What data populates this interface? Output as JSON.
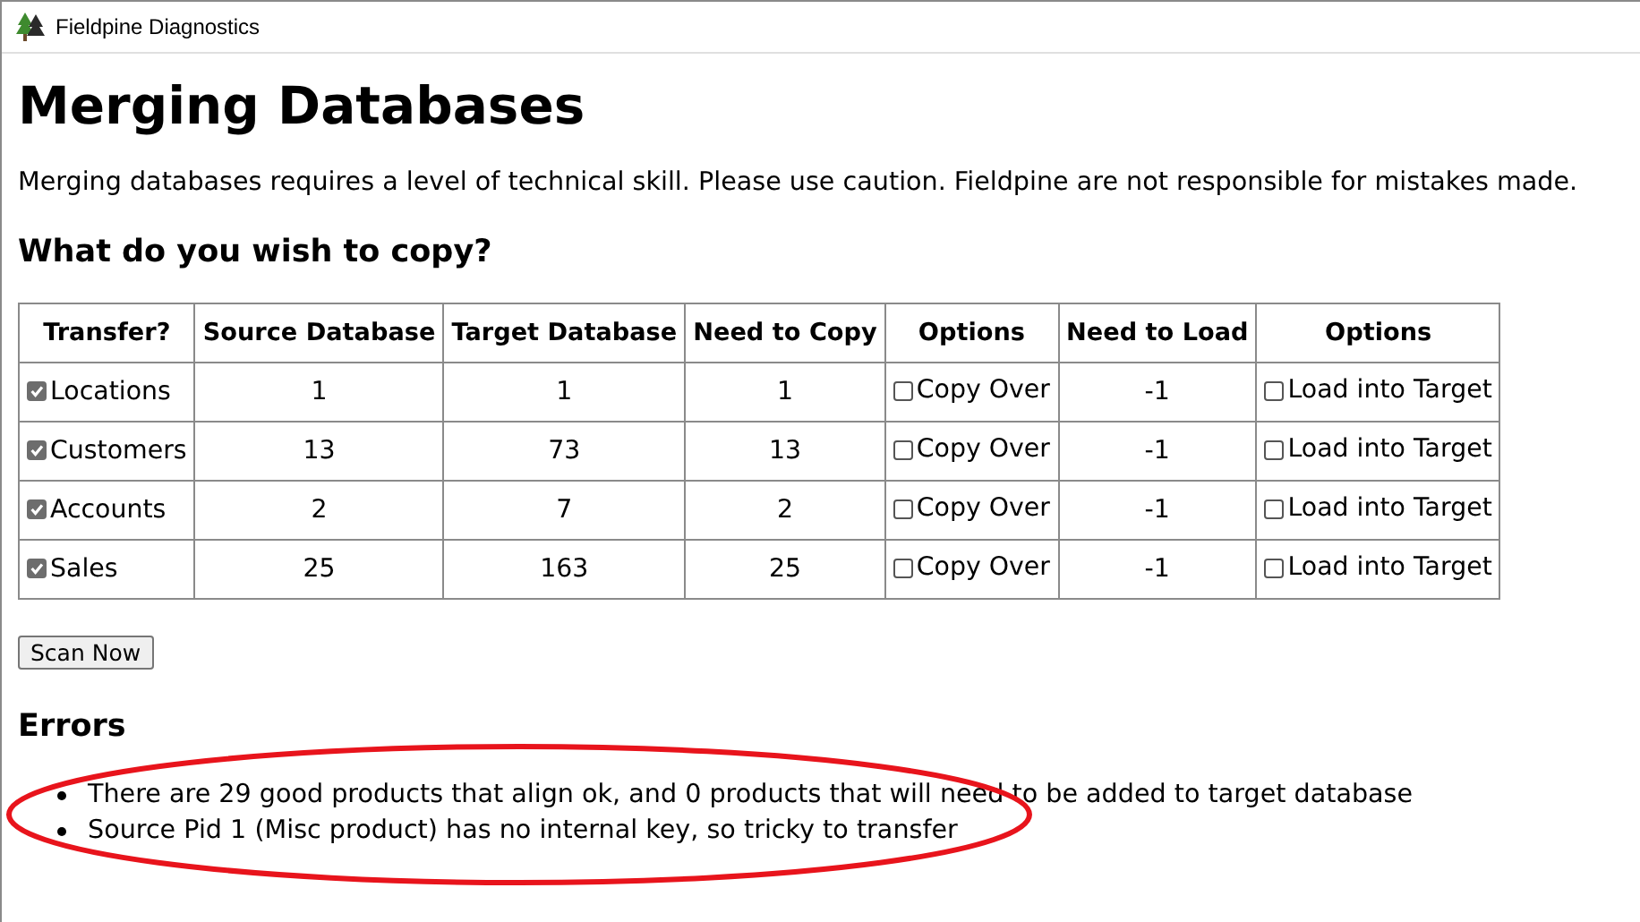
{
  "window": {
    "title": "Fieldpine Diagnostics"
  },
  "heading": "Merging Databases",
  "warning": "Merging databases requires a level of technical skill. Please use caution. Fieldpine are not responsible for mistakes made.",
  "subheading": "What do you wish to copy?",
  "table": {
    "columns": [
      "Transfer?",
      "Source Database",
      "Target Database",
      "Need to Copy",
      "Options",
      "Need to Load",
      "Options"
    ],
    "rows": [
      {
        "name": "Locations",
        "checked": true,
        "source": "1",
        "target": "1",
        "need_copy": "1",
        "copy_option": {
          "label": "Copy Over",
          "checked": false
        },
        "need_load": "-1",
        "load_option": {
          "label": "Load into Target",
          "checked": false
        }
      },
      {
        "name": "Customers",
        "checked": true,
        "source": "13",
        "target": "73",
        "need_copy": "13",
        "copy_option": {
          "label": "Copy Over",
          "checked": false
        },
        "need_load": "-1",
        "load_option": {
          "label": "Load into Target",
          "checked": false
        }
      },
      {
        "name": "Accounts",
        "checked": true,
        "source": "2",
        "target": "7",
        "need_copy": "2",
        "copy_option": {
          "label": "Copy Over",
          "checked": false
        },
        "need_load": "-1",
        "load_option": {
          "label": "Load into Target",
          "checked": false
        }
      },
      {
        "name": "Sales",
        "checked": true,
        "source": "25",
        "target": "163",
        "need_copy": "25",
        "copy_option": {
          "label": "Copy Over",
          "checked": false
        },
        "need_load": "-1",
        "load_option": {
          "label": "Load into Target",
          "checked": false
        }
      }
    ]
  },
  "scan_button": "Scan Now",
  "errors": {
    "title": "Errors",
    "items": [
      "There are 29 good products that align ok, and 0 products that will need to be added to target database",
      "Source Pid 1 (Misc product) has no internal key, so tricky to transfer"
    ]
  }
}
